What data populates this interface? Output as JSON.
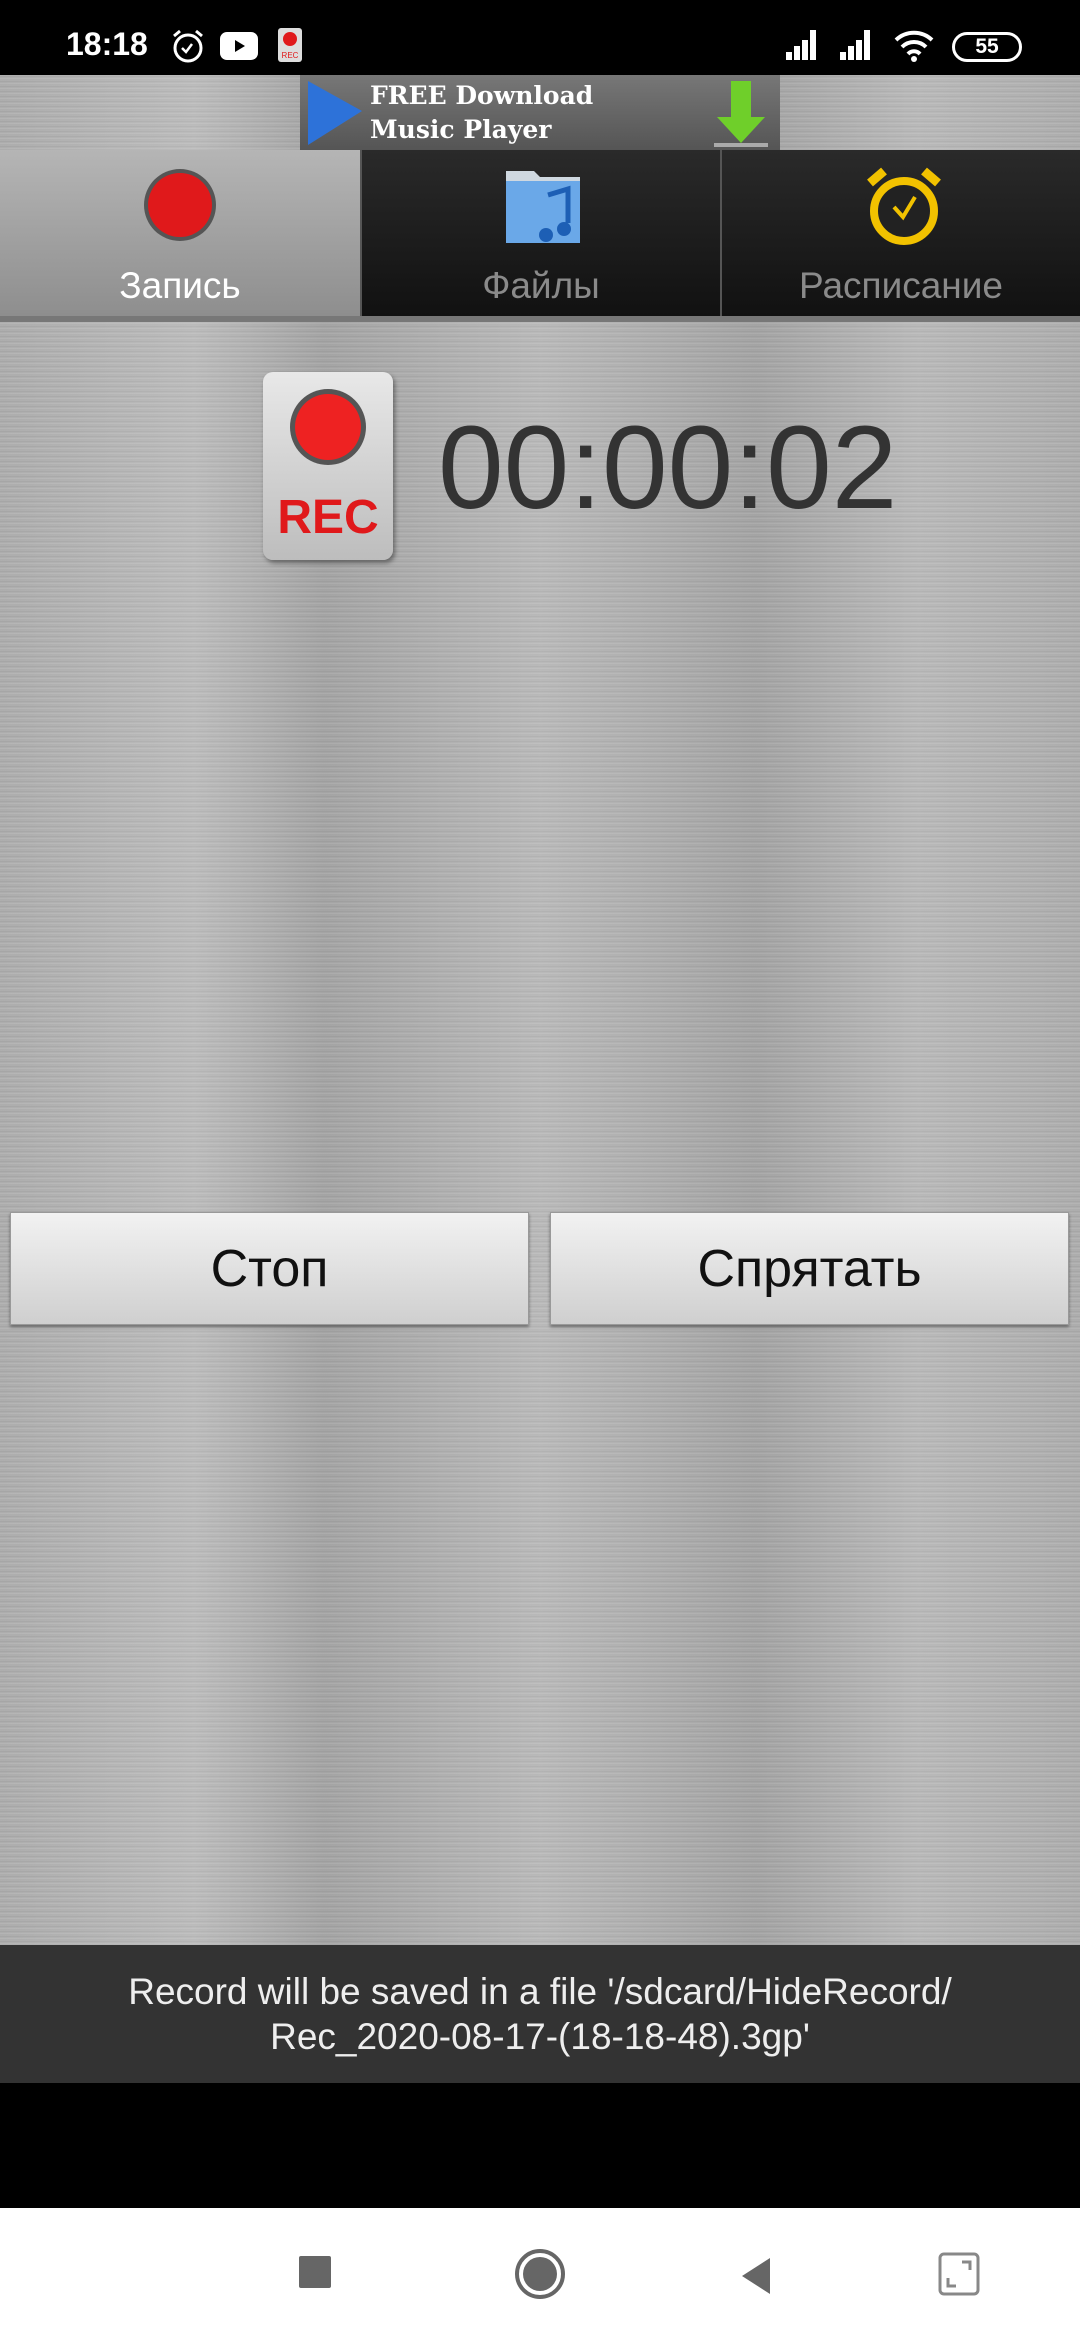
{
  "status_bar": {
    "time": "18:18",
    "battery": "55",
    "icons": [
      "alarm-icon",
      "youtube-icon",
      "rec-app-icon",
      "signal-icon",
      "signal-icon",
      "wifi-icon",
      "battery-icon"
    ]
  },
  "ad": {
    "line1": "FREE Download",
    "line2": "Music Player"
  },
  "tabs": [
    {
      "label": "Запись",
      "icon": "record-icon",
      "active": true
    },
    {
      "label": "Файлы",
      "icon": "music-folder-icon",
      "active": false
    },
    {
      "label": "Расписание",
      "icon": "alarm-clock-icon",
      "active": false
    }
  ],
  "recorder": {
    "badge": "REC",
    "timer": "00:00:02"
  },
  "buttons": {
    "stop": "Стоп",
    "hide": "Спрятать"
  },
  "toast": {
    "line1": "Record will be saved in a file '/sdcard/HideRecord/",
    "line2": "Rec_2020-08-17-(18-18-48).3gp'"
  },
  "colors": {
    "record_red": "#e0191b",
    "accent_yellow": "#f2c200",
    "toast_bg": "#333333"
  }
}
